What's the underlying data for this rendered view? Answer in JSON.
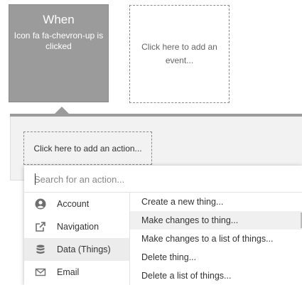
{
  "event": {
    "title": "When",
    "description": "Icon fa fa-chevron-up is clicked"
  },
  "add_event_label": "Click here to add an event...",
  "add_action_label": "Click here to add an action...",
  "search": {
    "placeholder": "Search for an action...",
    "value": ""
  },
  "categories": [
    {
      "label": "Account",
      "icon": "account-circle-icon"
    },
    {
      "label": "Navigation",
      "icon": "external-link-icon"
    },
    {
      "label": "Data (Things)",
      "icon": "database-icon",
      "selected": true
    },
    {
      "label": "Email",
      "icon": "envelope-icon"
    }
  ],
  "actions": [
    {
      "label": "Create a new thing..."
    },
    {
      "label": "Make changes to thing...",
      "hovered": true
    },
    {
      "label": "Make changes to a list of things..."
    },
    {
      "label": "Delete thing..."
    },
    {
      "label": "Delete a list of things..."
    }
  ],
  "colors": {
    "event_card": "#9b9b9b",
    "panel": "#f2f2f2",
    "selected_row": "#ececec"
  }
}
